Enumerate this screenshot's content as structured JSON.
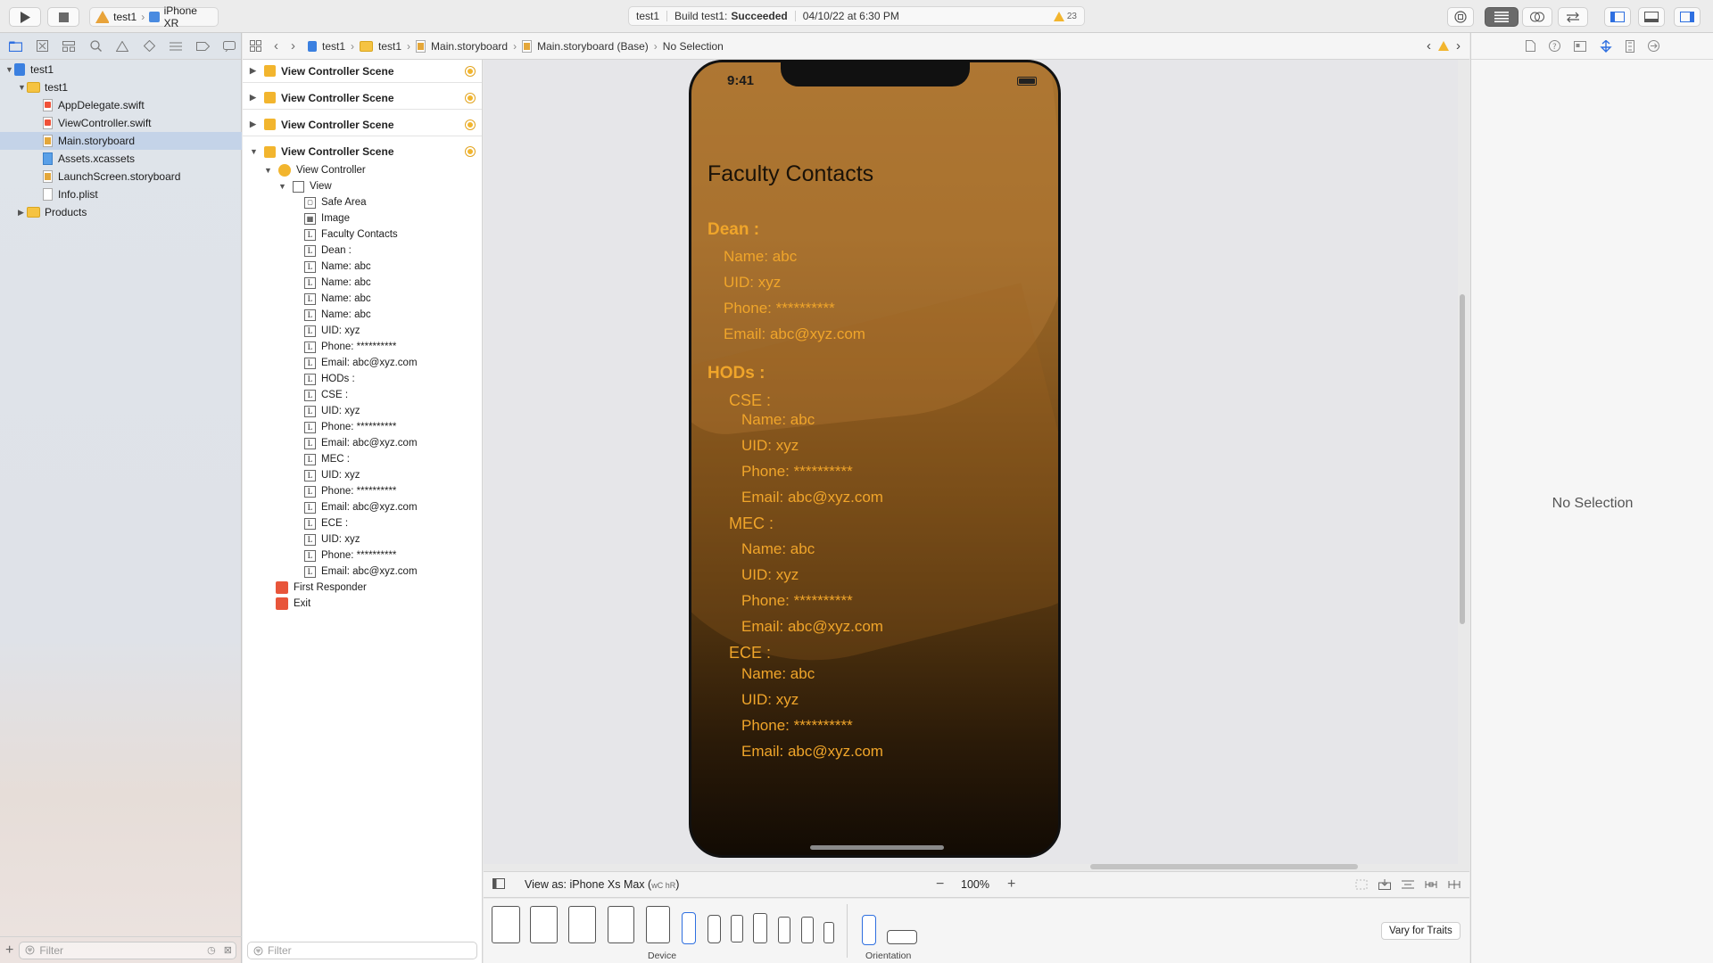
{
  "toolbar": {
    "scheme_project": "test1",
    "scheme_device": "iPhone XR",
    "activity_project": "test1",
    "activity_build_prefix": "Build test1:",
    "activity_status": "Succeeded",
    "activity_time": "04/10/22 at 6:30 PM",
    "warning_count": "23"
  },
  "navigator": {
    "items": [
      {
        "label": "test1",
        "kind": "project"
      },
      {
        "label": "test1",
        "kind": "folder"
      },
      {
        "label": "AppDelegate.swift",
        "kind": "swift"
      },
      {
        "label": "ViewController.swift",
        "kind": "swift"
      },
      {
        "label": "Main.storyboard",
        "kind": "storyboard",
        "selected": true
      },
      {
        "label": "Assets.xcassets",
        "kind": "assets"
      },
      {
        "label": "LaunchScreen.storyboard",
        "kind": "storyboard"
      },
      {
        "label": "Info.plist",
        "kind": "plist"
      },
      {
        "label": "Products",
        "kind": "folder"
      }
    ],
    "filter_placeholder": "Filter"
  },
  "jumpbar": {
    "crumbs": [
      "test1",
      "test1",
      "Main.storyboard",
      "Main.storyboard (Base)",
      "No Selection"
    ]
  },
  "outline": {
    "scenes": [
      "View Controller Scene",
      "View Controller Scene",
      "View Controller Scene",
      "View Controller Scene"
    ],
    "view_controller": "View Controller",
    "view": "View",
    "safe_area": "Safe Area",
    "image": "Image",
    "labels": [
      "Faculty Contacts",
      "Dean :",
      "Name: abc",
      "Name: abc",
      "Name: abc",
      "Name: abc",
      "UID: xyz",
      "Phone: **********",
      "Email: abc@xyz.com",
      "HODs :",
      "CSE :",
      "UID: xyz",
      "Phone: **********",
      "Email: abc@xyz.com",
      "MEC :",
      "UID: xyz",
      "Phone: **********",
      "Email: abc@xyz.com",
      "ECE :",
      "UID: xyz",
      "Phone: **********",
      "Email: abc@xyz.com"
    ],
    "first_responder": "First Responder",
    "exit": "Exit",
    "filter_placeholder": "Filter"
  },
  "phone": {
    "time": "9:41",
    "title": "Faculty Contacts",
    "dean_heading": "Dean :",
    "dean": [
      "Name: abc",
      "UID: xyz",
      "Phone: **********",
      "Email: abc@xyz.com"
    ],
    "hods_heading": "HODs :",
    "cse_heading": "CSE :",
    "cse": [
      "Name: abc",
      "UID: xyz",
      "Phone: **********",
      "Email: abc@xyz.com"
    ],
    "mec_heading": "MEC :",
    "mec": [
      "Name: abc",
      "UID: xyz",
      "Phone: **********",
      "Email: abc@xyz.com"
    ],
    "ece_heading": "ECE :",
    "ece": [
      "Name: abc",
      "UID: xyz",
      "Phone: **********",
      "Email: abc@xyz.com"
    ]
  },
  "canvas_bottom": {
    "view_as": "View as: iPhone Xs Max (",
    "view_as_traits": "wC hR",
    "view_as_close": ")",
    "zoom": "100%"
  },
  "device_bar": {
    "device_label": "Device",
    "orientation_label": "Orientation",
    "vary_for_traits": "Vary for Traits"
  },
  "inspector": {
    "no_selection": "No Selection"
  },
  "colors": {
    "accent": "#f0a52a",
    "selection": "#c4d3e8",
    "warning": "#f2b52e"
  }
}
